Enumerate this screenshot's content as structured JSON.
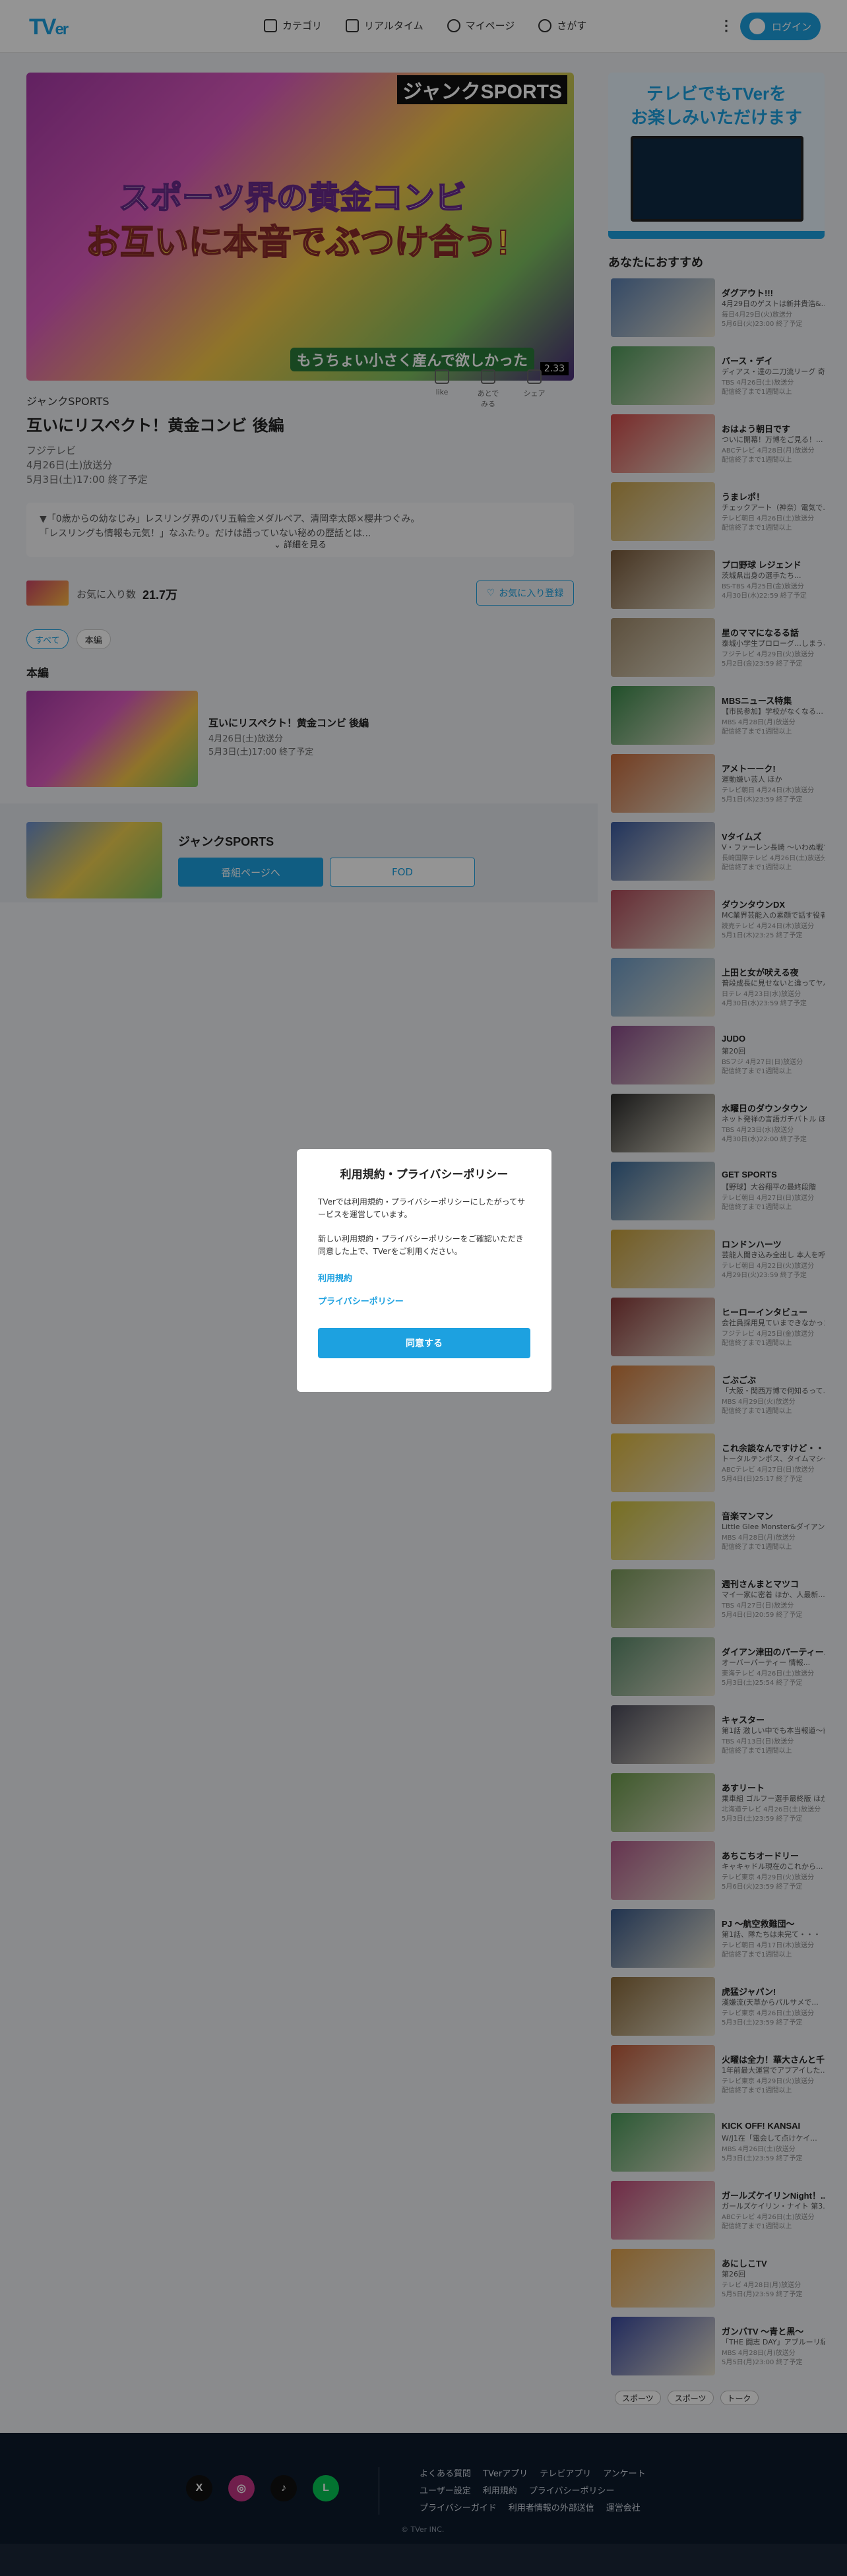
{
  "header": {
    "logo_main": "TV",
    "logo_sub": "er",
    "nav": [
      {
        "label": "カテゴリ"
      },
      {
        "label": "リアルタイム"
      },
      {
        "label": "マイページ"
      },
      {
        "label": "さがす"
      }
    ],
    "login_label": "ログイン"
  },
  "hero": {
    "brand": "ジャンクSPORTS",
    "line1": "スポーツ界の黄金コンビ",
    "line2": "お互いに本音でぶつけ合う!",
    "caption": "もうちょい小さく産んで欲しかった",
    "age_badge": "2.33"
  },
  "episode": {
    "series": "ジャンクSPORTS",
    "title": "互いにリスペクト！黄金コンビ 後編",
    "broadcaster": "フジテレビ",
    "aired": "4月26日(土)放送分",
    "expires": "5月3日(土)17:00 終了予定",
    "actions": [
      {
        "label": "like"
      },
      {
        "label": "あとでみる"
      },
      {
        "label": "シェア"
      }
    ],
    "description_1": "▼「0歳からの幼なじみ」レスリング界のパリ五輪金メダルペア、清岡幸太郎×櫻井つぐみ。",
    "description_2": "「レスリングも情報も元気！」なふたり。だけは語っていない秘めの歴話とは...",
    "more_label": "詳細を見る"
  },
  "favorite": {
    "label": "お気に入り数",
    "count": "21.7万",
    "button": "お気に入り登録"
  },
  "filters": [
    {
      "label": "すべて"
    },
    {
      "label": "本編"
    }
  ],
  "section_title": "本編",
  "episode_card": {
    "title": "互いにリスペクト！黄金コンビ 後編",
    "aired": "4月26日(土)放送分",
    "expires": "5月3日(土)17:00 終了予定"
  },
  "series_band": {
    "name": "ジャンクSPORTS",
    "button1": "番組ページへ",
    "button2": "FOD"
  },
  "promo": {
    "line1": "テレビでもTVerを",
    "line2": "お楽しみいただけます"
  },
  "sidebar_heading": "あなたにおすすめ",
  "recommended": [
    {
      "title": "ダグアウト!!!",
      "sub": "4月29日のゲストは新井貴浩&...",
      "date": "毎日4月29日(火)放送分",
      "exp": "5月6日(火)23:00 終了予定",
      "color": "#5a7fb0"
    },
    {
      "title": "バース・デイ",
      "sub": "ディアス・達の二刀流リーグ 奇跡...",
      "date": "TBS 4月26日(土)放送分",
      "exp": "配信終了まで1週間以上",
      "color": "#4f9a5a"
    },
    {
      "title": "おはよう朝日です",
      "sub": "ついに開幕！万博をご見る！...",
      "date": "ABCテレビ 4月28日(月)放送分",
      "exp": "配信終了まで1週間以上",
      "color": "#d24a4a"
    },
    {
      "title": "うまレポ！",
      "sub": "チェックアート（神奈）電気で...",
      "date": "テレビ朝日 4月26日(土)放送分",
      "exp": "配信終了まで1週間以上",
      "color": "#c8a24a"
    },
    {
      "title": "プロ野球 レジェンド",
      "sub": "茨城県出身の選手たち...",
      "date": "BS-TBS 4月25日(金)放送分",
      "exp": "4月30日(水)22:59 終了予定",
      "color": "#7a5a3a"
    },
    {
      "title": "星のママになるる話",
      "sub": "泰城小学生プロローグ…しまう、本...",
      "date": "フジテレビ 4月29日(火)放送分",
      "exp": "5月2日(金)23:59 終了予定",
      "color": "#a08a6a"
    },
    {
      "title": "MBSニュース特集",
      "sub": "【市民参加】学校がなくなる…",
      "date": "MBS 4月28日(月)放送分",
      "exp": "配信終了まで1週間以上",
      "color": "#3a8a4a"
    },
    {
      "title": "アメトーーク!",
      "sub": "運動嫌い芸人 ほか",
      "date": "テレビ朝日 4月24日(木)放送分",
      "exp": "5月1日(木)23:59 終了予定",
      "color": "#c86a3a"
    },
    {
      "title": "Vタイムズ",
      "sub": "V・ファーレン長崎 ～いわぬ戦で...",
      "date": "長崎国際テレビ 4月26日(土)放送分",
      "exp": "配信終了まで1週間以上",
      "color": "#3a5aa0"
    },
    {
      "title": "ダウンタウンDX",
      "sub": "MC業界芸能入の素顔で話す役者...",
      "date": "読売テレビ 4月24日(木)放送分",
      "exp": "5月1日(木)23:25 終了予定",
      "color": "#b04a5a"
    },
    {
      "title": "上田と女が吠える夜",
      "sub": "普段成長に見せないと違ってヤバ...",
      "date": "日テレ 4月23日(水)放送分",
      "exp": "4月30日(水)23:59 終了予定",
      "color": "#6a9ac8"
    },
    {
      "title": "JUDO",
      "sub": "第20回",
      "date": "BSフジ 4月27日(日)放送分",
      "exp": "配信終了まで1週間以上",
      "color": "#8a4a8a"
    },
    {
      "title": "水曜日のダウンタウン",
      "sub": "ネット発祥の言語ガチバトル ほか",
      "date": "TBS 4月23日(水)放送分",
      "exp": "4月30日(水)22:00 終了予定",
      "color": "#2a2a2a"
    },
    {
      "title": "GET SPORTS",
      "sub": "【野球】大谷翔平の最終段階",
      "date": "テレビ朝日 4月27日(日)放送分",
      "exp": "配信終了まで1週間以上",
      "color": "#3a6a9a"
    },
    {
      "title": "ロンドンハーツ",
      "sub": "芸能人聞き込み全出し 本人を呼んで...",
      "date": "テレビ朝日 4月22日(火)放送分",
      "exp": "4月29日(火)23:59 終了予定",
      "color": "#c8a03a"
    },
    {
      "title": "ヒーローインタビュー",
      "sub": "会社員採用見ていまできなかった...",
      "date": "フジテレビ 4月25日(金)放送分",
      "exp": "配信終了まで1週間以上",
      "color": "#8a3a3a"
    },
    {
      "title": "ごぶごぶ",
      "sub": "「大阪・関西万博で何知るって...」",
      "date": "MBS 4月29日(火)放送分",
      "exp": "配信終了まで1週間以上",
      "color": "#d07a3a"
    },
    {
      "title": "これ余談なんですけど・・・",
      "sub": "トータルテンボス、タイムマシーン...",
      "date": "ABCテレビ 4月27日(日)放送分",
      "exp": "5月4日(日)25:17 終了予定",
      "color": "#e0b83a"
    },
    {
      "title": "音楽マンマン",
      "sub": "Little Glee Monster&ダイアン...",
      "date": "MBS 4月28日(月)放送分",
      "exp": "配信終了まで1週間以上",
      "color": "#d0c03a"
    },
    {
      "title": "週刊さんまとマツコ",
      "sub": "マイ一家に密着 ほか、人最新...",
      "date": "TBS 4月27日(日)放送分",
      "exp": "5月4日(日)20:59 終了予定",
      "color": "#7a9a5a"
    },
    {
      "title": "ダイアン津田のパーティー...",
      "sub": "オーバーパーティー 情報...",
      "date": "東海テレビ 4月26日(土)放送分",
      "exp": "5月3日(土)25:54 終了予定",
      "color": "#5a8a6a"
    },
    {
      "title": "キャスター",
      "sub": "第1話 激しい中でも本当報道～前線...",
      "date": "TBS 4月13日(日)放送分",
      "exp": "配信終了まで1週間以上",
      "color": "#4a4a5a"
    },
    {
      "title": "あすリート",
      "sub": "乗車組 ゴルフー選手最終版 ほか",
      "date": "北海道テレビ 4月26日(土)放送分",
      "exp": "5月3日(土)23:59 終了予定",
      "color": "#6a9a4a"
    },
    {
      "title": "あちこちオードリー",
      "sub": "キャキャドル現在のこれから...",
      "date": "テレビ東京 4月29日(火)放送分",
      "exp": "5月6日(火)23:59 終了予定",
      "color": "#b05a8a"
    },
    {
      "title": "PJ ～航空救難団～",
      "sub": "第1話、隊たちは未完て・・・",
      "date": "テレビ朝日 4月17日(木)放送分",
      "exp": "配信終了まで1週間以上",
      "color": "#3a5a8a"
    },
    {
      "title": "虎猛ジャパン!",
      "sub": "漢嫌流(天草からパルサメで...",
      "date": "テレビ東京 4月26日(土)放送分",
      "exp": "5月3日(土)23:59 終了予定",
      "color": "#8a6a3a"
    },
    {
      "title": "火曜は全力！華大さんと千...",
      "sub": "1年前最大運営でアプアイした...",
      "date": "テレビ東京 4月29日(火)放送分",
      "exp": "配信終了まで1週間以上",
      "color": "#c05a3a"
    },
    {
      "title": "KICK OFF! KANSAI",
      "sub": "W/J1在「電会して点けケイ...",
      "date": "MBS 4月26日(土)放送分",
      "exp": "5月3日(土)23:59 終了予定",
      "color": "#4a9a5a"
    },
    {
      "title": "ガールズケイリンNight！...",
      "sub": "ガールズケイリン・ナイト 第3...",
      "date": "ABCテレビ 4月26日(土)放送分",
      "exp": "配信終了まで1週間以上",
      "color": "#c04a7a"
    },
    {
      "title": "あにしこTV",
      "sub": "第26回",
      "date": "テレビ 4月28日(月)放送分",
      "exp": "5月5日(月)23:59 終了予定",
      "color": "#e0a04a"
    },
    {
      "title": "ガンバTV ～青と黒～",
      "sub": "「THE 闘志 DAY」アブルーリ紀...",
      "date": "MBS 4月28日(月)放送分",
      "exp": "5月5日(月)23:00 終了予定",
      "color": "#3a4aa0"
    }
  ],
  "side_tags": [
    {
      "label": "スポーツ"
    },
    {
      "label": "スポーツ"
    },
    {
      "label": "トーク"
    }
  ],
  "footer": {
    "links_row1": [
      "よくある質問",
      "TVerアプリ",
      "テレビアプリ",
      "アンケート"
    ],
    "links_row2": [
      "ユーザー設定",
      "利用規約",
      "プライバシーポリシー"
    ],
    "links_row3": [
      "プライバシーガイド",
      "利用者情報の外部送信",
      "運営会社"
    ],
    "copyright": "© TVer INC.",
    "socials": [
      {
        "icon": "x-icon",
        "glyph": "X",
        "color": "#111111"
      },
      {
        "icon": "instagram-icon",
        "glyph": "◎",
        "color": "#c13584"
      },
      {
        "icon": "tiktok-icon",
        "glyph": "♪",
        "color": "#111111"
      },
      {
        "icon": "line-icon",
        "glyph": "L",
        "color": "#06c755"
      }
    ]
  },
  "modal": {
    "title": "利用規約・プライバシーポリシー",
    "body1": "TVerでは利用規約・プライバシーポリシーにしたがってサービスを運営しています。",
    "body2": "新しい利用規約・プライバシーポリシーをご確認いただき同意した上で、TVerをご利用ください。",
    "link1": "利用規約",
    "link2": "プライバシーポリシー",
    "agree": "同意する"
  }
}
